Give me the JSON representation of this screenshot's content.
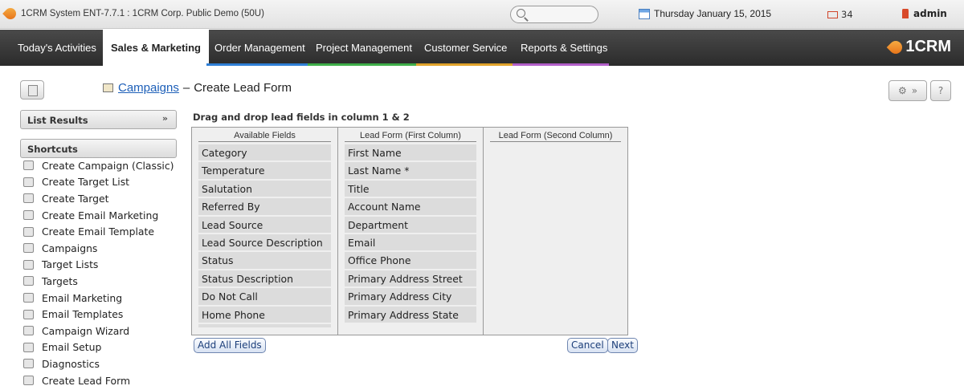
{
  "window": {
    "title": "1CRM System ENT-7.7.1 : 1CRM Corp. Public Demo (50U)"
  },
  "topbar": {
    "date": "Thursday January 15, 2015",
    "mail_count": "34",
    "user": "admin"
  },
  "nav": {
    "tabs": [
      {
        "label": "Today's Activities"
      },
      {
        "label": "Sales & Marketing"
      },
      {
        "label": "Order Management"
      },
      {
        "label": "Project Management"
      },
      {
        "label": "Customer Service"
      },
      {
        "label": "Reports & Settings"
      }
    ],
    "active_tab": "Sales & Marketing",
    "logo": "1CRM",
    "colors": {
      "accent": "#e56a12",
      "nav_bg": "#2b2b2b"
    }
  },
  "header": {
    "breadcrumb_link": "Campaigns",
    "separator": "–",
    "page_title": "Create Lead Form"
  },
  "sidebar": {
    "list_results": "List Results",
    "shortcuts_title": "Shortcuts",
    "shortcuts": [
      {
        "label": "Create Campaign (Classic)"
      },
      {
        "label": "Create Target List"
      },
      {
        "label": "Create Target"
      },
      {
        "label": "Create Email Marketing"
      },
      {
        "label": "Create Email Template"
      },
      {
        "label": "Campaigns"
      },
      {
        "label": "Target Lists"
      },
      {
        "label": "Targets"
      },
      {
        "label": "Email Marketing"
      },
      {
        "label": "Email Templates"
      },
      {
        "label": "Campaign Wizard"
      },
      {
        "label": "Email Setup"
      },
      {
        "label": "Diagnostics"
      },
      {
        "label": "Create Lead Form"
      }
    ]
  },
  "form": {
    "instruction": "Drag and drop lead fields in column 1 & 2",
    "columns": [
      {
        "header": "Available Fields",
        "fields": [
          "Category",
          "Temperature",
          "Salutation",
          "Referred By",
          "Lead Source",
          "Lead Source Description",
          "Status",
          "Status Description",
          "Do Not Call",
          "Home Phone"
        ]
      },
      {
        "header": "Lead Form (First Column)",
        "fields": [
          "First Name",
          "Last Name *",
          "Title",
          "Account Name",
          "Department",
          "Email",
          "Office Phone",
          "Primary Address Street",
          "Primary Address City",
          "Primary Address State"
        ]
      },
      {
        "header": "Lead Form (Second Column)",
        "fields": []
      }
    ],
    "buttons": {
      "add_all": "Add All Fields",
      "cancel": "Cancel",
      "next": "Next"
    }
  }
}
